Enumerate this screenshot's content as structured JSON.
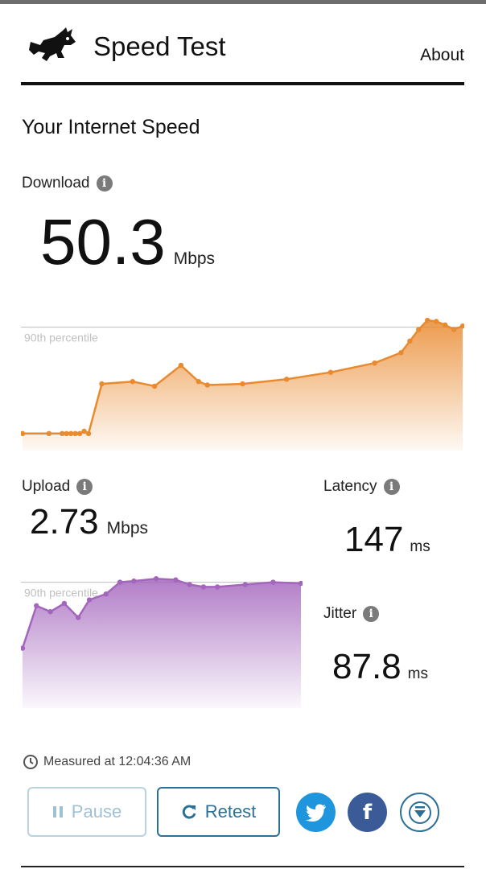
{
  "app": {
    "title": "Speed Test",
    "about_label": "About"
  },
  "section_title": "Your Internet Speed",
  "download": {
    "label": "Download",
    "value": "50.3",
    "unit": "Mbps"
  },
  "upload": {
    "label": "Upload",
    "value": "2.73",
    "unit": "Mbps"
  },
  "latency": {
    "label": "Latency",
    "value": "147",
    "unit": "ms"
  },
  "jitter": {
    "label": "Jitter",
    "value": "87.8",
    "unit": "ms"
  },
  "percentile_label": "90th percentile",
  "measured_text": "Measured at 12:04:36 AM",
  "buttons": {
    "pause": "Pause",
    "retest": "Retest"
  },
  "icons": {
    "logo": "rabbit-logo-icon",
    "info": "info-icon",
    "clock": "clock-icon",
    "pause": "pause-icon",
    "retest": "refresh-icon",
    "twitter": "twitter-icon",
    "facebook": "facebook-icon",
    "save": "download-arrow-icon"
  },
  "colors": {
    "download": "#e98a2f",
    "upload": "#a466bd",
    "accent": "#2b7197"
  },
  "chart_data": [
    {
      "type": "area",
      "series": [
        {
          "x": [
            0,
            6,
            9,
            10,
            11,
            12,
            13,
            14,
            15,
            18,
            25,
            30,
            36,
            40,
            42,
            50,
            60,
            70,
            80,
            86,
            88,
            90,
            92,
            94,
            96,
            98,
            100
          ],
          "values": [
            0.05,
            0.05,
            0.05,
            0.05,
            0.05,
            0.05,
            0.05,
            0.07,
            0.05,
            0.48,
            0.5,
            0.46,
            0.64,
            0.5,
            0.47,
            0.48,
            0.52,
            0.58,
            0.66,
            0.75,
            0.85,
            0.95,
            1.03,
            1.02,
            0.99,
            0.95,
            0.98
          ]
        }
      ],
      "percentile": 0.97,
      "xlim": [
        0,
        100
      ],
      "ylim": [
        0,
        1.1
      ]
    },
    {
      "type": "area",
      "series": [
        {
          "x": [
            0,
            5,
            10,
            15,
            20,
            24,
            30,
            35,
            40,
            48,
            55,
            60,
            65,
            70,
            80,
            90,
            100
          ],
          "values": [
            0.44,
            0.8,
            0.75,
            0.82,
            0.7,
            0.85,
            0.9,
            1.0,
            1.01,
            1.03,
            1.02,
            0.98,
            0.96,
            0.96,
            0.98,
            1.0,
            0.99
          ],
          "name": ""
        }
      ],
      "percentile": 1.0,
      "xlim": [
        0,
        100
      ],
      "ylim": [
        0,
        1.12
      ]
    }
  ]
}
